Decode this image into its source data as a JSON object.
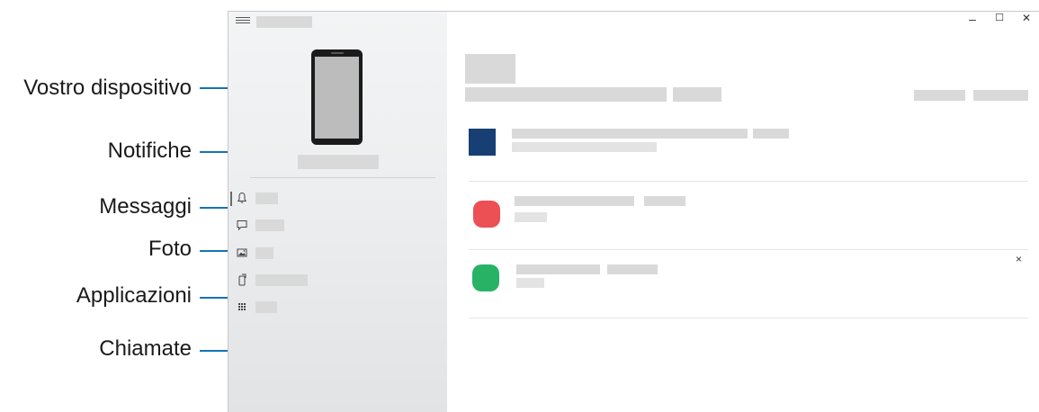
{
  "callouts": {
    "device": "Vostro dispositivo",
    "notifications": "Notifiche",
    "messages": "Messaggi",
    "photos": "Foto",
    "apps": "Applicazioni",
    "calls": "Chiamate"
  },
  "window_controls": {
    "minimize": "–",
    "maximize": "☐",
    "close": "✕"
  },
  "main": {
    "dismiss_glyph": "×"
  },
  "icons": {
    "menu": "hamburger-icon",
    "notifications": "bell-icon",
    "messages": "chat-bubble-icon",
    "photos": "image-icon",
    "apps": "phone-apps-icon",
    "calls": "dialpad-icon"
  },
  "colors": {
    "callout_line": "#1673b8",
    "app_blue": "#173f73",
    "app_red": "#ec4f54",
    "app_green": "#27b266"
  }
}
